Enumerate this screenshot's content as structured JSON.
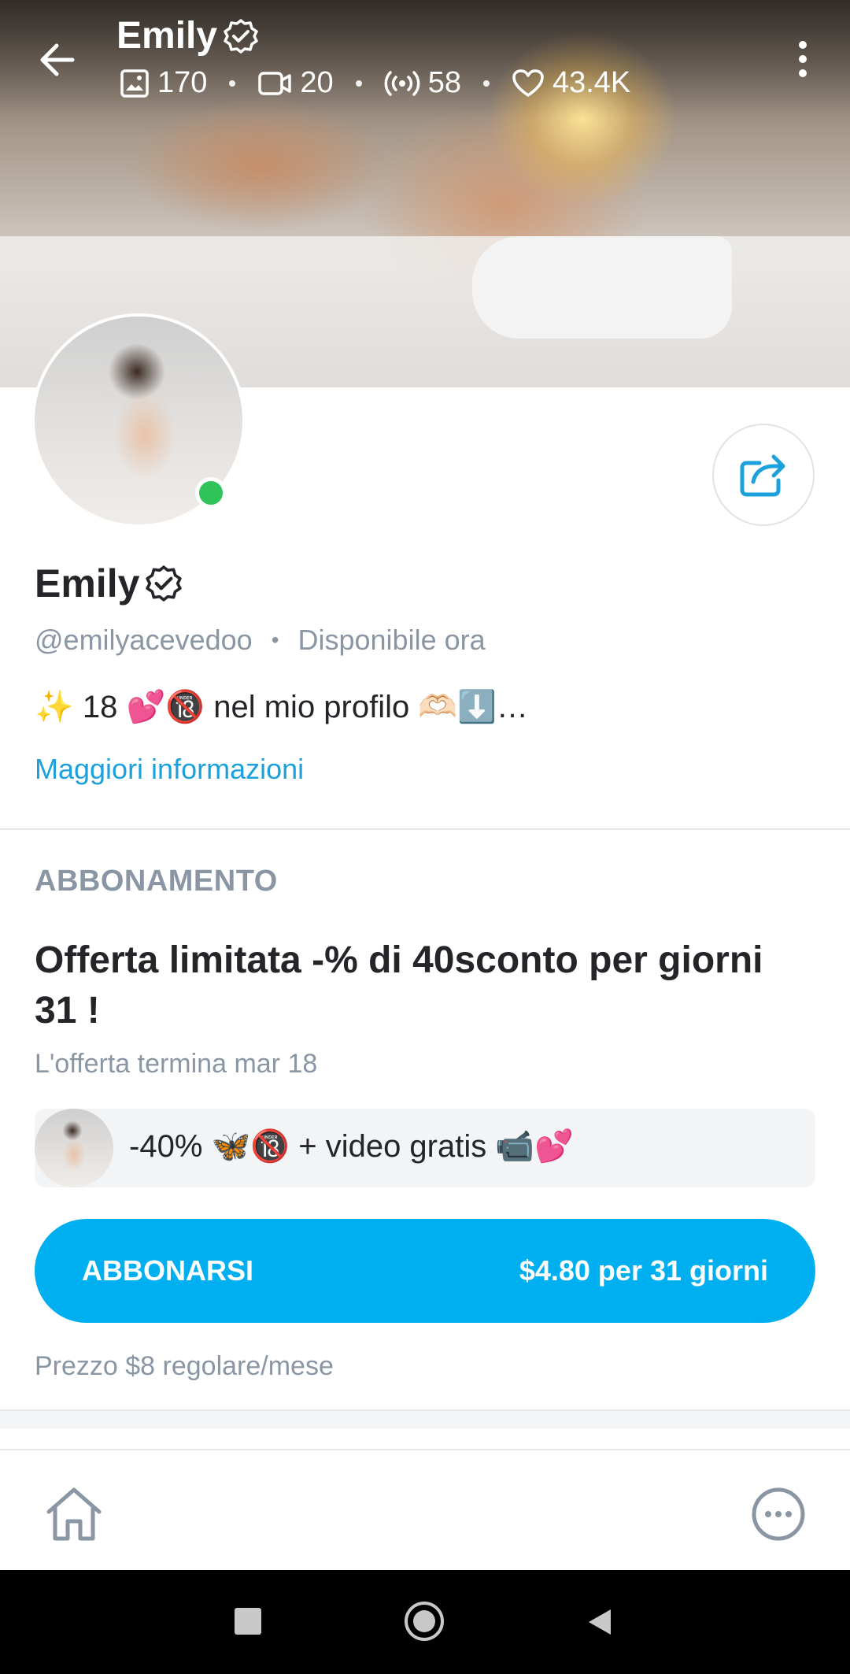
{
  "header": {
    "name": "Emily",
    "stats": {
      "photos": "170",
      "videos": "20",
      "streams": "58",
      "likes": "43.4K"
    }
  },
  "profile": {
    "name": "Emily",
    "handle": "@emilyacevedoo",
    "status": "Disponibile ora",
    "bio": "✨ 18 💕🔞 nel mio profilo 🫶🏻⬇️…",
    "more_info": "Maggiori informazioni"
  },
  "subscription": {
    "section_label": "ABBONAMENTO",
    "offer_title": "Offerta limitata -% di 40sconto per giorni 31 !",
    "offer_ends": "L'offerta termina mar 18",
    "promo_text": "-40% 🦋🔞 + video gratis 📹💕",
    "button_label": "ABBONARSI",
    "button_price": "$4.80 per 31 giorni",
    "regular_price": "Prezzo $8 regolare/mese"
  },
  "colors": {
    "accent": "#00aff0",
    "link": "#1da1dc",
    "muted": "#8a96a3",
    "online": "#2fc35a"
  },
  "icons": {
    "back": "arrow-left-icon",
    "verified": "verified-badge-icon",
    "photos": "image-icon",
    "videos": "video-camera-icon",
    "streams": "broadcast-icon",
    "likes": "heart-icon",
    "menu": "kebab-menu-icon",
    "share": "share-icon",
    "home": "home-icon",
    "more": "more-dots-icon"
  }
}
